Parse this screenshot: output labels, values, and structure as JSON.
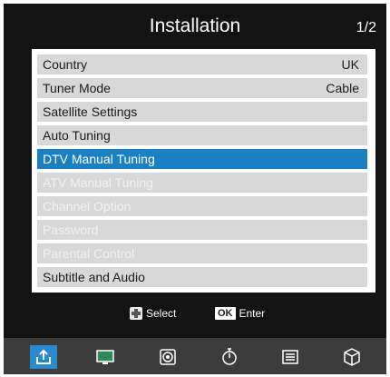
{
  "header": {
    "title": "Installation",
    "page_indicator": "1/2"
  },
  "menu": {
    "items": [
      {
        "label": "Country",
        "value": "UK",
        "state": "normal"
      },
      {
        "label": "Tuner Mode",
        "value": "Cable",
        "state": "normal"
      },
      {
        "label": "Satellite Settings",
        "value": "",
        "state": "normal"
      },
      {
        "label": "Auto Tuning",
        "value": "",
        "state": "normal"
      },
      {
        "label": "DTV Manual Tuning",
        "value": "",
        "state": "selected"
      },
      {
        "label": "ATV Manual Tuning",
        "value": "",
        "state": "disabled"
      },
      {
        "label": "Channel Option",
        "value": "",
        "state": "disabled"
      },
      {
        "label": "Password",
        "value": "",
        "state": "disabled"
      },
      {
        "label": "Parental Control",
        "value": "",
        "state": "disabled"
      },
      {
        "label": "Subtitle and Audio",
        "value": "",
        "state": "normal"
      }
    ]
  },
  "hints": {
    "select_label": "Select",
    "ok_key": "OK",
    "enter_label": "Enter"
  },
  "bottom_bar": {
    "icons": [
      {
        "name": "installation-icon",
        "active": true
      },
      {
        "name": "picture-icon",
        "active": false
      },
      {
        "name": "sound-icon",
        "active": false
      },
      {
        "name": "timer-icon",
        "active": false
      },
      {
        "name": "setup-icon",
        "active": false
      },
      {
        "name": "lock-icon",
        "active": false
      }
    ]
  },
  "colors": {
    "selected_bg": "#1a80c4",
    "item_bg": "#d8d8d8",
    "disabled_text": "#f2f2f2",
    "active_icon_bg": "#2a8ad0"
  }
}
